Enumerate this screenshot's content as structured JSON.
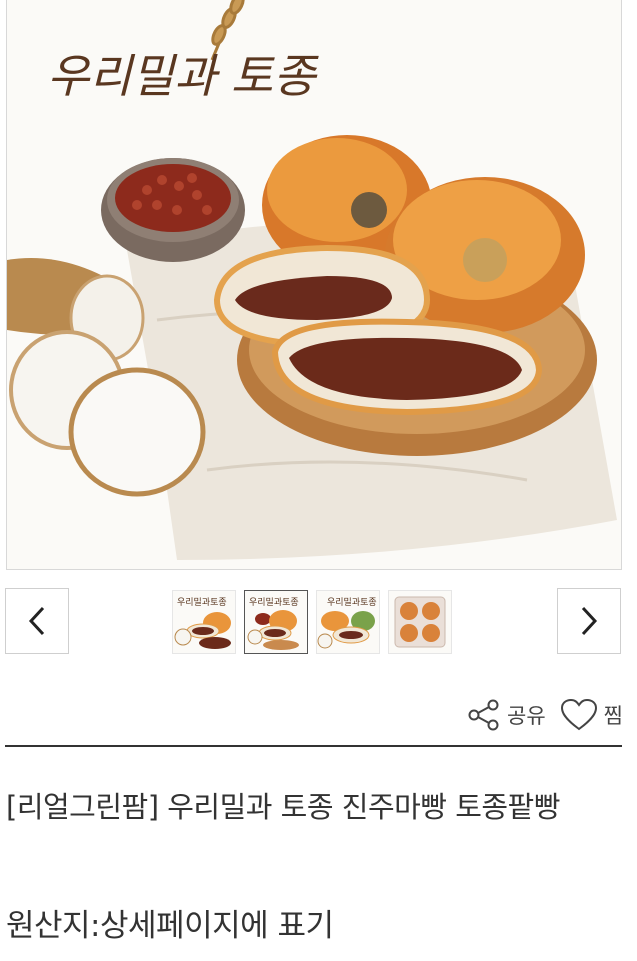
{
  "hero": {
    "logo_text": "우리밀과 토종",
    "colors": {
      "crust": "#e08d2a",
      "beans": "#6b2418",
      "yam_skin": "#b98a4f",
      "plate": "#c98a4e"
    }
  },
  "gallery": {
    "prev_icon": "chevron-left-icon",
    "next_icon": "chevron-right-icon",
    "thumbnails": [
      {
        "alt": "product photo 1",
        "active": false
      },
      {
        "alt": "product photo 2",
        "active": true
      },
      {
        "alt": "product photo 3",
        "active": false
      },
      {
        "alt": "product photo 4",
        "active": false
      }
    ]
  },
  "actions": {
    "share_label": "공유",
    "wish_label": "찜"
  },
  "product": {
    "title": "[리얼그린팜] 우리밀과 토종 진주마빵 토종팥빵",
    "origin": "원산지:상세페이지에 표기"
  }
}
